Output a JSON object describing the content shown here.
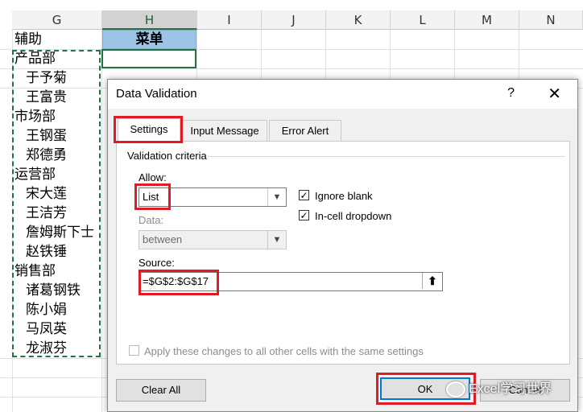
{
  "sheet": {
    "columns": [
      "G",
      "H",
      "I",
      "J",
      "K",
      "L",
      "M",
      "N"
    ],
    "g_cells": [
      "辅助",
      "产品部",
      "于予菊",
      "王富贵",
      "市场部",
      "王钢蛋",
      "郑德勇",
      "运营部",
      "宋大莲",
      "王洁芳",
      "詹姆斯下士",
      "赵铁锤",
      "销售部",
      "诸葛钢铁",
      "陈小娟",
      "马凤英",
      "龙淑芬"
    ],
    "header_h": "菜单"
  },
  "dialog": {
    "title": "Data Validation",
    "help": "?",
    "close": "✕",
    "tabs": [
      "Settings",
      "Input Message",
      "Error Alert"
    ],
    "group": "Validation criteria",
    "allow_label": "Allow:",
    "allow_value": "List",
    "data_label": "Data:",
    "data_value": "between",
    "ignore_blank": "Ignore blank",
    "incell_dropdown": "In-cell dropdown",
    "source_label": "Source:",
    "source_value": "=$G$2:$G$17",
    "apply_all": "Apply these changes to all other cells with the same settings",
    "clear_all": "Clear All",
    "ok": "OK",
    "cancel": "Cancel"
  },
  "watermark": "Excel学习世界",
  "colors": {
    "accent_red": "#e01b24",
    "header_fill": "#9dc3e6",
    "excel_green": "#217346"
  }
}
